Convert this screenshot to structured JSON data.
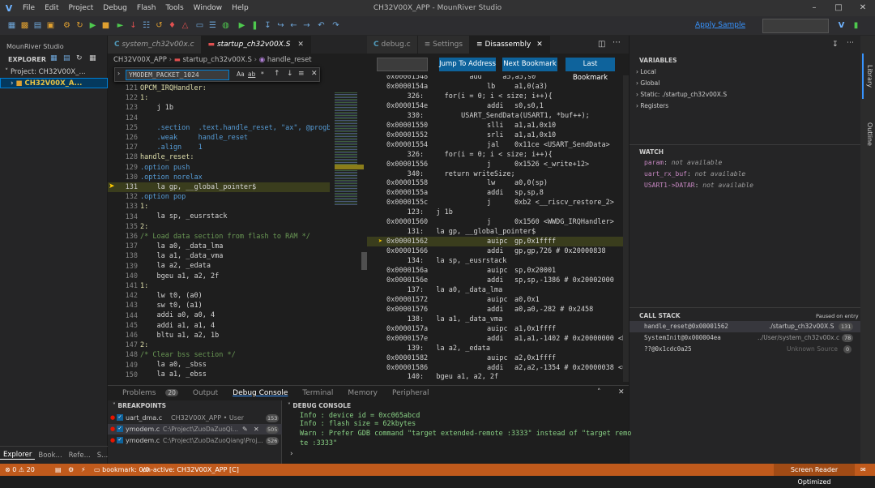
{
  "app": {
    "title": "CH32V00X_APP - MounRiver Studio",
    "menu": [
      "File",
      "Edit",
      "Project",
      "Debug",
      "Flash",
      "Tools",
      "Window",
      "Help"
    ]
  },
  "toolbar": {
    "apply_sample": "Apply Sample"
  },
  "sidebar": {
    "title": "MounRiver Studio",
    "explorer": "EXPLORER",
    "project": "Project: CH32V00X_...",
    "tree_item": "CH32V00X_A...",
    "bottom_tabs": [
      "Explorer",
      "Book...",
      "Refe...",
      "S..."
    ]
  },
  "editor1": {
    "tabs": [
      "system_ch32v00x.c",
      "startup_ch32v00X.S"
    ],
    "breadcrumb": [
      "CH32V00X_APP",
      "startup_ch32v00X.S",
      "handle_reset"
    ],
    "find": {
      "value": "YMODEM_PACKET_1024",
      "options": [
        "Aa",
        "ab",
        "*"
      ]
    },
    "line_numbers": [
      "121",
      "122",
      "123",
      "124",
      "125",
      "126",
      "127",
      "128",
      "129",
      "130",
      "131",
      "132",
      "133",
      "134",
      "135",
      "136",
      "137",
      "138",
      "139",
      "140",
      "141",
      "142",
      "143",
      "144",
      "145",
      "146",
      "147",
      "148",
      "149",
      "150"
    ],
    "code": [
      "OPCM_IRQHandler:",
      "1:",
      "    j 1b",
      "",
      "    .section  .text.handle_reset, \"ax\", @progbi",
      "    .weak     handle_reset",
      "    .align    1",
      "handle_reset:",
      ".option push",
      ".option norelax",
      "    la gp, __global_pointer$",
      ".option pop",
      "1:",
      "    la sp, _eusrstack",
      "2:",
      "/* Load data section from flash to RAM */",
      "    la a0, _data_lma",
      "    la a1, _data_vma",
      "    la a2, _edata",
      "    bgeu a1, a2, 2f",
      "1:",
      "    lw t0, (a0)",
      "    sw t0, (a1)",
      "    addi a0, a0, 4",
      "    addi a1, a1, 4",
      "    bltu a1, a2, 1b",
      "2:",
      "/* Clear bss section */",
      "    la a0, _sbss",
      "    la a1, _ebss"
    ],
    "current_line": "131"
  },
  "editor2": {
    "tabs": [
      "debug.c",
      "Settings",
      "Disassembly"
    ],
    "buttons": {
      "jump": "Jump To Address",
      "next": "Next Bookmark",
      "last": "Last Bookmark"
    },
    "lines": [
      {
        "t": "src",
        "text": "0x00001548          add     a5,a5,s0"
      },
      {
        "t": "ins",
        "addr": "0x0000154a",
        "op": "lb",
        "args": "a1,0(a3)"
      },
      {
        "t": "src",
        "text": "     326:     for(i = 0; i < size; i++){"
      },
      {
        "t": "ins",
        "addr": "0x0000154e",
        "op": "addi",
        "args": "s0,s0,1"
      },
      {
        "t": "src",
        "text": "     330:         USART_SendData(USART1, *buf++);"
      },
      {
        "t": "ins",
        "addr": "0x00001550",
        "op": "slli",
        "args": "a1,a1,0x10"
      },
      {
        "t": "ins",
        "addr": "0x00001552",
        "op": "srli",
        "args": "a1,a1,0x10"
      },
      {
        "t": "ins",
        "addr": "0x00001554",
        "op": "jal",
        "args": "0x11ce <USART_SendData>"
      },
      {
        "t": "src",
        "text": "     326:     for(i = 0; i < size; i++){"
      },
      {
        "t": "ins",
        "addr": "0x00001556",
        "op": "j",
        "args": "0x1526 <_write+12>"
      },
      {
        "t": "src",
        "text": "     340:     return writeSize;"
      },
      {
        "t": "ins",
        "addr": "0x00001558",
        "op": "lw",
        "args": "a0,0(sp)"
      },
      {
        "t": "ins",
        "addr": "0x0000155a",
        "op": "addi",
        "args": "sp,sp,8"
      },
      {
        "t": "ins",
        "addr": "0x0000155c",
        "op": "j",
        "args": "0xb2 <__riscv_restore_2>"
      },
      {
        "t": "src",
        "text": "     123:   j 1b"
      },
      {
        "t": "ins",
        "addr": "0x00001560",
        "op": "j",
        "args": "0x1560 <WWDG_IRQHandler>"
      },
      {
        "t": "src",
        "text": "     131:   la gp, __global_pointer$"
      },
      {
        "t": "cur",
        "addr": "0x00001562",
        "op": "auipc",
        "args": "gp,0x1ffff"
      },
      {
        "t": "ins",
        "addr": "0x00001566",
        "op": "addi",
        "args": "gp,gp,726 # 0x20000838"
      },
      {
        "t": "src",
        "text": "     134:   la sp, _eusrstack"
      },
      {
        "t": "ins",
        "addr": "0x0000156a",
        "op": "auipc",
        "args": "sp,0x20001"
      },
      {
        "t": "ins",
        "addr": "0x0000156e",
        "op": "addi",
        "args": "sp,sp,-1386 # 0x20002000"
      },
      {
        "t": "src",
        "text": "     137:   la a0, _data_lma"
      },
      {
        "t": "ins",
        "addr": "0x00001572",
        "op": "auipc",
        "args": "a0,0x1"
      },
      {
        "t": "ins",
        "addr": "0x00001576",
        "op": "addi",
        "args": "a0,a0,-282 # 0x2458"
      },
      {
        "t": "src",
        "text": "     138:   la a1, _data_vma"
      },
      {
        "t": "ins",
        "addr": "0x0000157a",
        "op": "auipc",
        "args": "a1,0x1ffff"
      },
      {
        "t": "ins",
        "addr": "0x0000157e",
        "op": "addi",
        "args": "a1,a1,-1402 # 0x20000000 <HB"
      },
      {
        "t": "src",
        "text": "     139:   la a2, _edata"
      },
      {
        "t": "ins",
        "addr": "0x00001582",
        "op": "auipc",
        "args": "a2,0x1ffff"
      },
      {
        "t": "ins",
        "addr": "0x00001586",
        "op": "addi",
        "args": "a2,a2,-1354 # 0x20000038 <ua"
      },
      {
        "t": "src",
        "text": "     140:   bgeu a1, a2, 2f"
      }
    ]
  },
  "right": {
    "variables_hdr": "VARIABLES",
    "variables": [
      "Local",
      "Global",
      "Static: ./startup_ch32v00X.S",
      "Registers"
    ],
    "watch_hdr": "WATCH",
    "watch": [
      {
        "name": "param",
        "value": "not available"
      },
      {
        "name": "uart_rx_buf",
        "value": "not available"
      },
      {
        "name": "USART1->DATAR",
        "value": "not available"
      }
    ],
    "callstack_hdr": "CALL STACK",
    "callstack_status": "Paused on entry",
    "callstack": [
      {
        "fn": "handle_reset@0x00001562",
        "file": "./startup_ch32v00X.S",
        "line": "131"
      },
      {
        "fn": "SystemInit@0x000004ea",
        "file": "../User/system_ch32v00x.c",
        "line": "78"
      },
      {
        "fn": "??@0x1cdc0a25",
        "file": "Unknown Source",
        "line": "0"
      }
    ],
    "activity": [
      "Library",
      "Outline"
    ]
  },
  "panel": {
    "tabs": [
      "Problems",
      "Output",
      "Debug Console",
      "Terminal",
      "Memory",
      "Peripheral"
    ],
    "problems_count": "20",
    "breakpoints_hdr": "BREAKPOINTS",
    "breakpoints": [
      {
        "file": "uart_dma.c",
        "path": "CH32V00X_APP • User",
        "line": "153"
      },
      {
        "file": "ymodem.c",
        "path": "C:\\Project\\ZuoDaZuoQi...",
        "line": "505"
      },
      {
        "file": "ymodem.c",
        "path": "C:\\Project\\ZuoDaZuoQiang\\Proj...",
        "line": "526"
      }
    ],
    "console_hdr": "DEBUG CONSOLE",
    "console": [
      "Info : device id = 0xc065abcd",
      "Info : flash size = 62kbytes",
      "Warn : Prefer GDB command \"target extended-remote :3333\" instead of \"target remo",
      "te :3333\""
    ]
  },
  "status": {
    "errors": "0",
    "warnings": "20",
    "bookmark": "bookmark: 0/0",
    "active": "on-active: CH32V00X_APP [C]",
    "screen_reader": "Screen Reader Optimized"
  },
  "colors": {
    "accent": "#0e639c",
    "status": "#c05a1c",
    "highlight": "#3a3d1d",
    "current_arrow": "#ffcc00"
  }
}
